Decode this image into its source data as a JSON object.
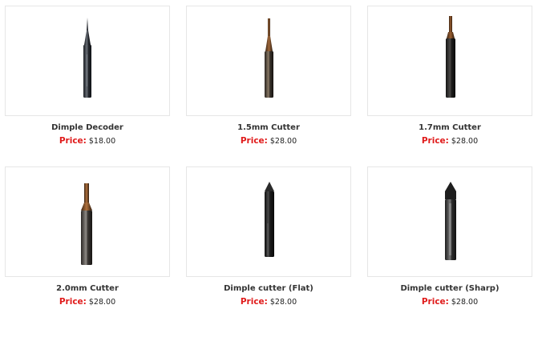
{
  "products": [
    {
      "name": "Dimple Decoder",
      "price_label": "Price:",
      "price": "$18.00",
      "icon": "dimple-decoder-icon"
    },
    {
      "name": "1.5mm Cutter",
      "price_label": "Price:",
      "price": "$28.00",
      "icon": "cutter-1-5mm-icon"
    },
    {
      "name": "1.7mm Cutter",
      "price_label": "Price:",
      "price": "$28.00",
      "icon": "cutter-1-7mm-icon"
    },
    {
      "name": "2.0mm Cutter",
      "price_label": "Price:",
      "price": "$28.00",
      "icon": "cutter-2-0mm-icon"
    },
    {
      "name": "Dimple cutter (Flat)",
      "price_label": "Price:",
      "price": "$28.00",
      "icon": "dimple-cutter-flat-icon"
    },
    {
      "name": "Dimple cutter (Sharp)",
      "price_label": "Price:",
      "price": "$28.00",
      "icon": "dimple-cutter-sharp-icon"
    }
  ],
  "colors": {
    "price_label": "#e01b1b",
    "card_border": "#e6e6e6",
    "name_text": "#333333"
  }
}
